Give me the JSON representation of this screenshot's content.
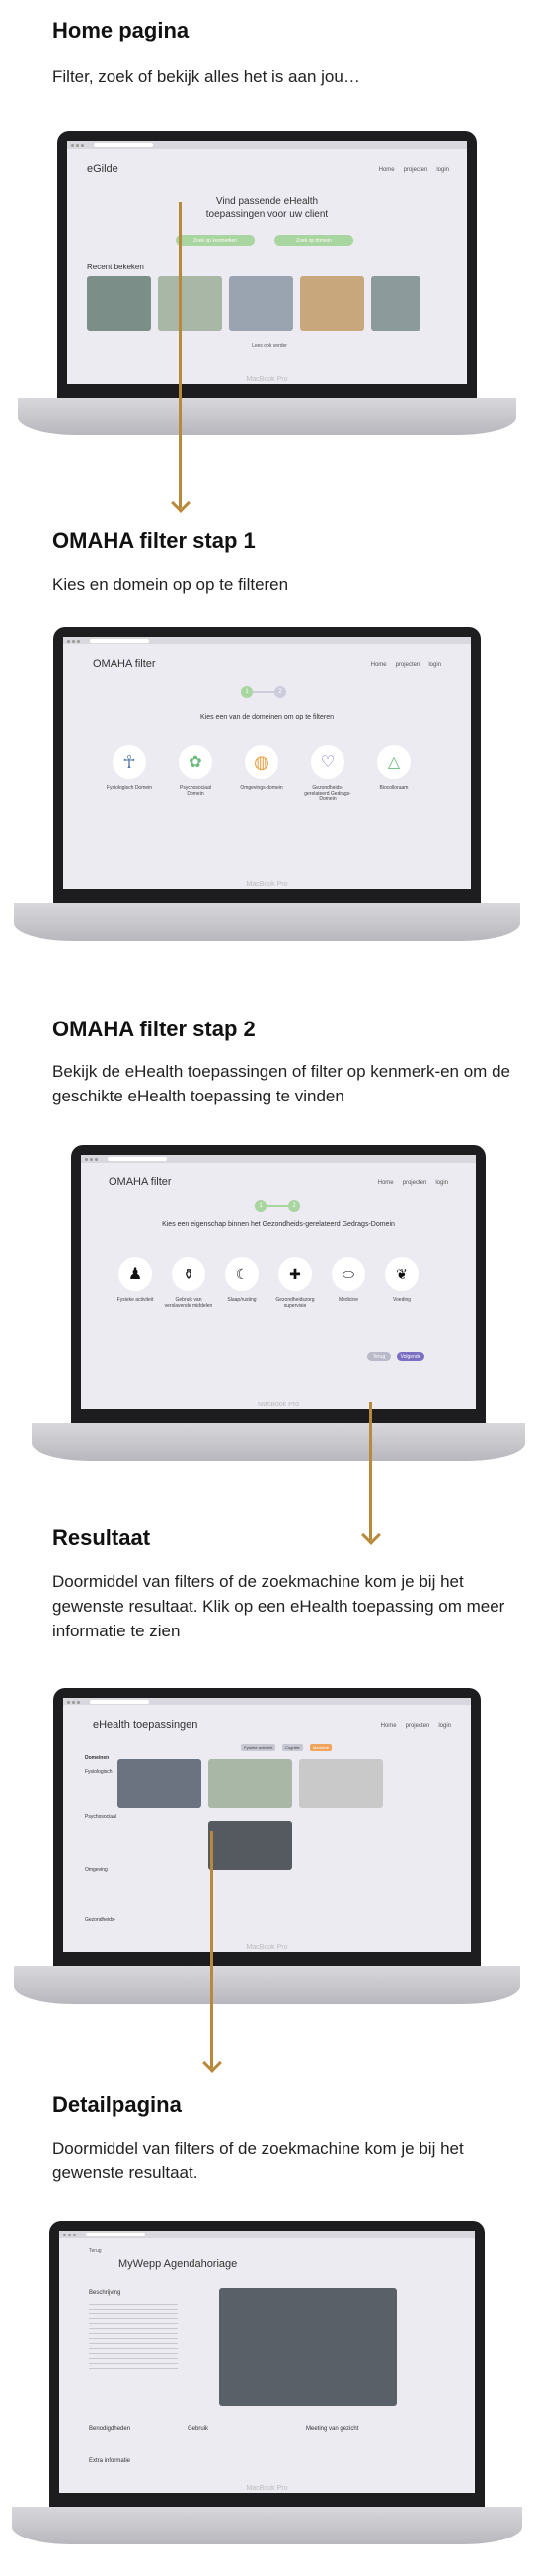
{
  "sections": [
    {
      "title": "Home pagina",
      "text": "Filter, zoek of bekijk alles het is aan jou…"
    },
    {
      "title": "OMAHA filter stap 1",
      "text": "Kies en domein op op te filteren"
    },
    {
      "title": "OMAHA filter stap 2",
      "text": "Bekijk de eHealth toepassingen of filter op kenmerk-en om de geschikte eHealth toepassing te vinden"
    },
    {
      "title": "Resultaat",
      "text": "Doormiddel van filters of de zoekmachine kom je bij het gewenste resultaat. Klik op een eHealth toepassing om meer informatie te zien"
    },
    {
      "title": "Detailpagina",
      "text": "Doormiddel van filters of de zoekmachine kom je bij het gewenste resultaat."
    }
  ],
  "laptop_label": "MacBook Pro",
  "nav": {
    "home": "Home",
    "projecten": "projecten",
    "login": "login"
  },
  "home": {
    "logo": "eGilde",
    "hero": "Vind passende eHealth toepassingen voor uw client",
    "btn1": "Zoek op kenmerken",
    "btn2": "Zoek op domein",
    "recent": "Recent bekeken",
    "scroll": "Lees ook verder"
  },
  "omaha1": {
    "logo": "OMAHA filter",
    "prompt": "Kies een van de domeinen om op te filteren",
    "domains": [
      "Fysiologisch Domein",
      "Psychosociaal Domein",
      "Omgevings-domein",
      "Gezondheids-gerelateerd Gedrags-Domein",
      "Biocolloraam"
    ]
  },
  "omaha2": {
    "logo": "OMAHA filter",
    "prompt": "Kies een eigenschap binnen het Gezondheids-gerelateerd Gedrags-Domein",
    "options": [
      "Fysieke activiteit",
      "Gebruik van verslavende middelen",
      "Slaap/rusting",
      "Gezondheidszorg supervisie",
      "Medicine",
      "Voeding"
    ],
    "back": "Terug",
    "next": "Volgende"
  },
  "result": {
    "logo": "eHealth toepassingen",
    "filters": [
      "Fysieke activiteit",
      "Cognitie",
      "Medicine"
    ],
    "sidebar": [
      "Domeinen",
      "Fysiologisch",
      "Psychosociaal",
      "Omgeving",
      "Gezondheids-"
    ]
  },
  "detail": {
    "back": "Terug",
    "title": "MyWepp Agendahoriage",
    "section": "Beschrijving",
    "labels": [
      "Benodigdheden",
      "Gebruik",
      "Meeting van gezicht",
      "Extra informatie"
    ]
  },
  "colors": {
    "accent": "#a8d5a0",
    "arrow": "#b8893a",
    "screen": "#ecebf2"
  }
}
